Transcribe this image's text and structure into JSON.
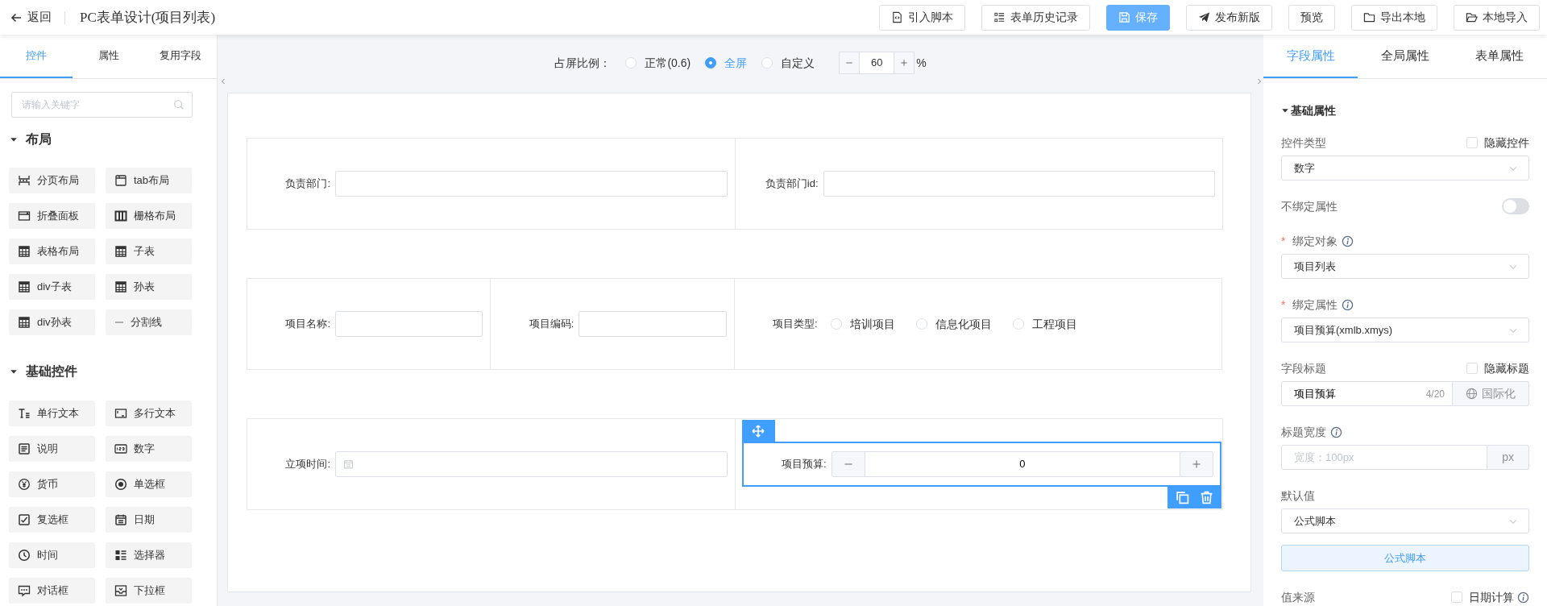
{
  "header": {
    "back_label": "返回",
    "title": "PC表单设计(项目列表)",
    "buttons": [
      {
        "label": "引入脚本",
        "kind": "default"
      },
      {
        "label": "表单历史记录",
        "kind": "default"
      },
      {
        "label": "保存",
        "kind": "primary"
      },
      {
        "label": "发布新版",
        "kind": "default"
      },
      {
        "label": "预览",
        "kind": "default"
      },
      {
        "label": "导出本地",
        "kind": "default"
      },
      {
        "label": "本地导入",
        "kind": "default"
      }
    ]
  },
  "left_panel": {
    "tabs": [
      {
        "label": "控件",
        "selected": true
      },
      {
        "label": "属性",
        "selected": false
      },
      {
        "label": "复用字段",
        "selected": false
      }
    ],
    "search": {
      "placeholder": "请输入关键字"
    },
    "groups": [
      {
        "title": "布局",
        "expanded": true,
        "items": [
          "分页布局",
          "tab布局",
          "折叠面板",
          "栅格布局",
          "表格布局",
          "子表",
          "div子表",
          "孙表",
          "div孙表",
          "分割线"
        ]
      },
      {
        "title": "基础控件",
        "expanded": true,
        "items": [
          "单行文本",
          "多行文本",
          "说明",
          "数字",
          "货币",
          "单选框",
          "复选框",
          "日期",
          "时间",
          "选择器",
          "对话框",
          "下拉框"
        ]
      }
    ]
  },
  "canvas": {
    "ratio": {
      "label": "占屏比例：",
      "options": [
        {
          "label": "正常(0.6)",
          "selected": false
        },
        {
          "label": "全屏",
          "selected": true
        },
        {
          "label": "自定义",
          "selected": false
        }
      ],
      "value": "60",
      "unit": "%"
    },
    "rows": [
      {
        "cells": [
          {
            "kind": "text",
            "label": "负责部门:",
            "selected": false
          },
          {
            "kind": "text",
            "label": "负责部门id:",
            "selected": false
          }
        ]
      },
      {
        "cells": [
          {
            "kind": "text",
            "label": "项目名称:",
            "selected": false
          },
          {
            "kind": "text",
            "label": "项目编码:",
            "selected": false
          },
          {
            "kind": "radio",
            "label": "项目类型:",
            "selected": false,
            "options": [
              {
                "label": "培训项目",
                "selected": false
              },
              {
                "label": "信息化项目",
                "selected": false
              },
              {
                "label": "工程项目",
                "selected": false
              }
            ]
          }
        ]
      },
      {
        "cells": [
          {
            "kind": "date",
            "label": "立项时间:",
            "selected": false
          },
          {
            "kind": "number",
            "label": "项目预算:",
            "value": "0",
            "selected": true
          }
        ]
      }
    ]
  },
  "right_panel": {
    "tabs": [
      {
        "label": "字段属性",
        "selected": true
      },
      {
        "label": "全局属性",
        "selected": false
      },
      {
        "label": "表单属性",
        "selected": false
      }
    ],
    "section": {
      "title": "基础属性",
      "expanded": true
    },
    "properties": [
      {
        "kind": "select",
        "label": "控件类型",
        "value": "数字",
        "checkbox": {
          "label": "隐藏控件",
          "checked": false
        }
      },
      {
        "kind": "switch",
        "label": "不绑定属性",
        "on": false
      },
      {
        "kind": "select",
        "mark": "*",
        "label": "绑定对象",
        "info": true,
        "value": "项目列表"
      },
      {
        "kind": "select",
        "mark": "*",
        "label": "绑定属性",
        "info": true,
        "value": "项目预算(xmlb.xmys)"
      },
      {
        "kind": "text",
        "label": "字段标题",
        "value": "项目预算",
        "count": "4/20",
        "addon": "国际化",
        "checkbox": {
          "label": "隐藏标题",
          "checked": false
        }
      },
      {
        "kind": "text",
        "label": "标题宽度",
        "info": true,
        "placeholder": "宽度：100px",
        "addon": "px"
      },
      {
        "kind": "select",
        "label": "默认值",
        "value": "公式脚本",
        "button": "公式脚本"
      },
      {
        "kind": "label",
        "label": "值来源",
        "checkbox": {
          "label": "日期计算",
          "checked": false,
          "info": true
        }
      }
    ]
  }
}
